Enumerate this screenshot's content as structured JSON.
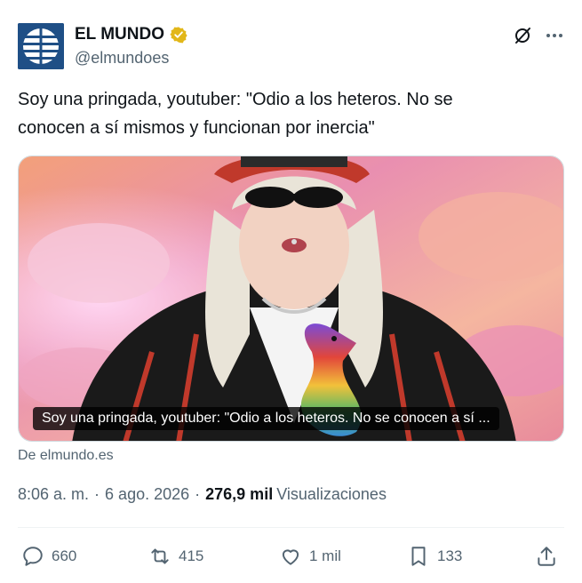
{
  "author": {
    "display_name": "EL MUNDO",
    "handle": "@elmundoes",
    "verified_color": "#e2b719",
    "avatar_bg": "#1f4f86"
  },
  "header_icons": {
    "grok": "grok-icon",
    "more": "more-icon"
  },
  "tweet": {
    "text": "Soy una pringada, youtuber: \"Odio a los heteros. No se\nconocen a sí mismos y funcionan por inercia\""
  },
  "card": {
    "title": "Soy una pringada, youtuber: \"Odio a los heteros. No se conocen a sí ...",
    "source": "De elmundo.es"
  },
  "meta": {
    "time": "8:06 a. m.",
    "separator": "·",
    "date": "6 ago. 2026",
    "views_count": "276,9 mil",
    "views_label": "Visualizaciones"
  },
  "actions": {
    "replies": "660",
    "reposts": "415",
    "likes": "1 mil",
    "bookmarks": "133"
  },
  "colors": {
    "text_primary": "#0f1419",
    "text_secondary": "#536471",
    "border": "#cfd9de"
  }
}
